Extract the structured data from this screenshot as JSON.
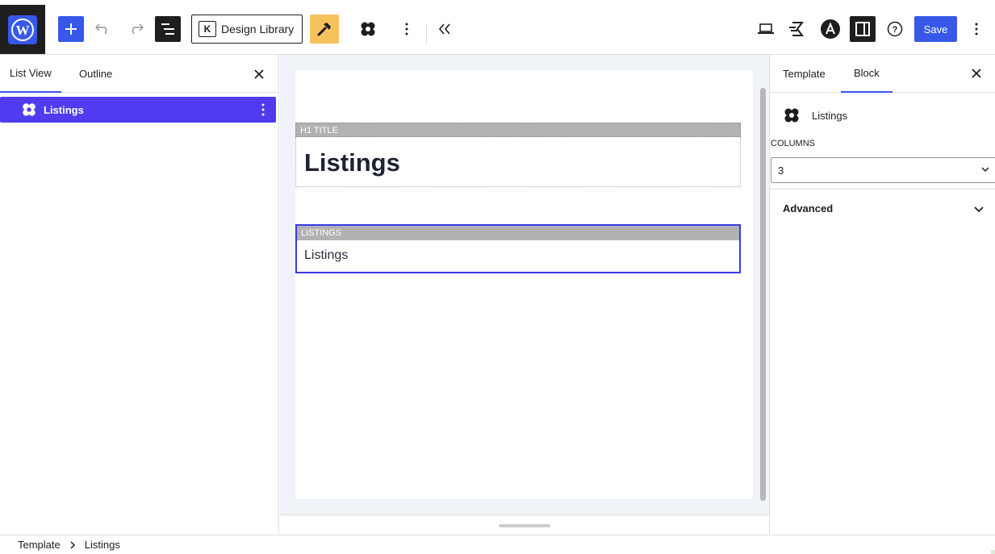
{
  "toolbar": {
    "design_library_label": "Design Library",
    "design_library_icon_letter": "K",
    "save_label": "Save",
    "accent_color": "#3858e9",
    "hammer_bg": "#f6c25b"
  },
  "left_panel": {
    "tabs": [
      {
        "label": "List View",
        "active": true
      },
      {
        "label": "Outline",
        "active": false
      }
    ],
    "items": [
      {
        "label": "Listings",
        "selected": true
      }
    ]
  },
  "canvas": {
    "h1_block_label": "H1 TITLE",
    "h1_text": "Listings",
    "listings_block_label": "LISTINGS",
    "listings_text": "Listings"
  },
  "right_panel": {
    "tabs": [
      {
        "label": "Template",
        "active": false
      },
      {
        "label": "Block",
        "active": true
      }
    ],
    "block_name": "Listings",
    "columns_label": "COLUMNS",
    "columns_value": "3",
    "advanced_label": "Advanced"
  },
  "breadcrumb": {
    "items": [
      "Template",
      "Listings"
    ]
  }
}
